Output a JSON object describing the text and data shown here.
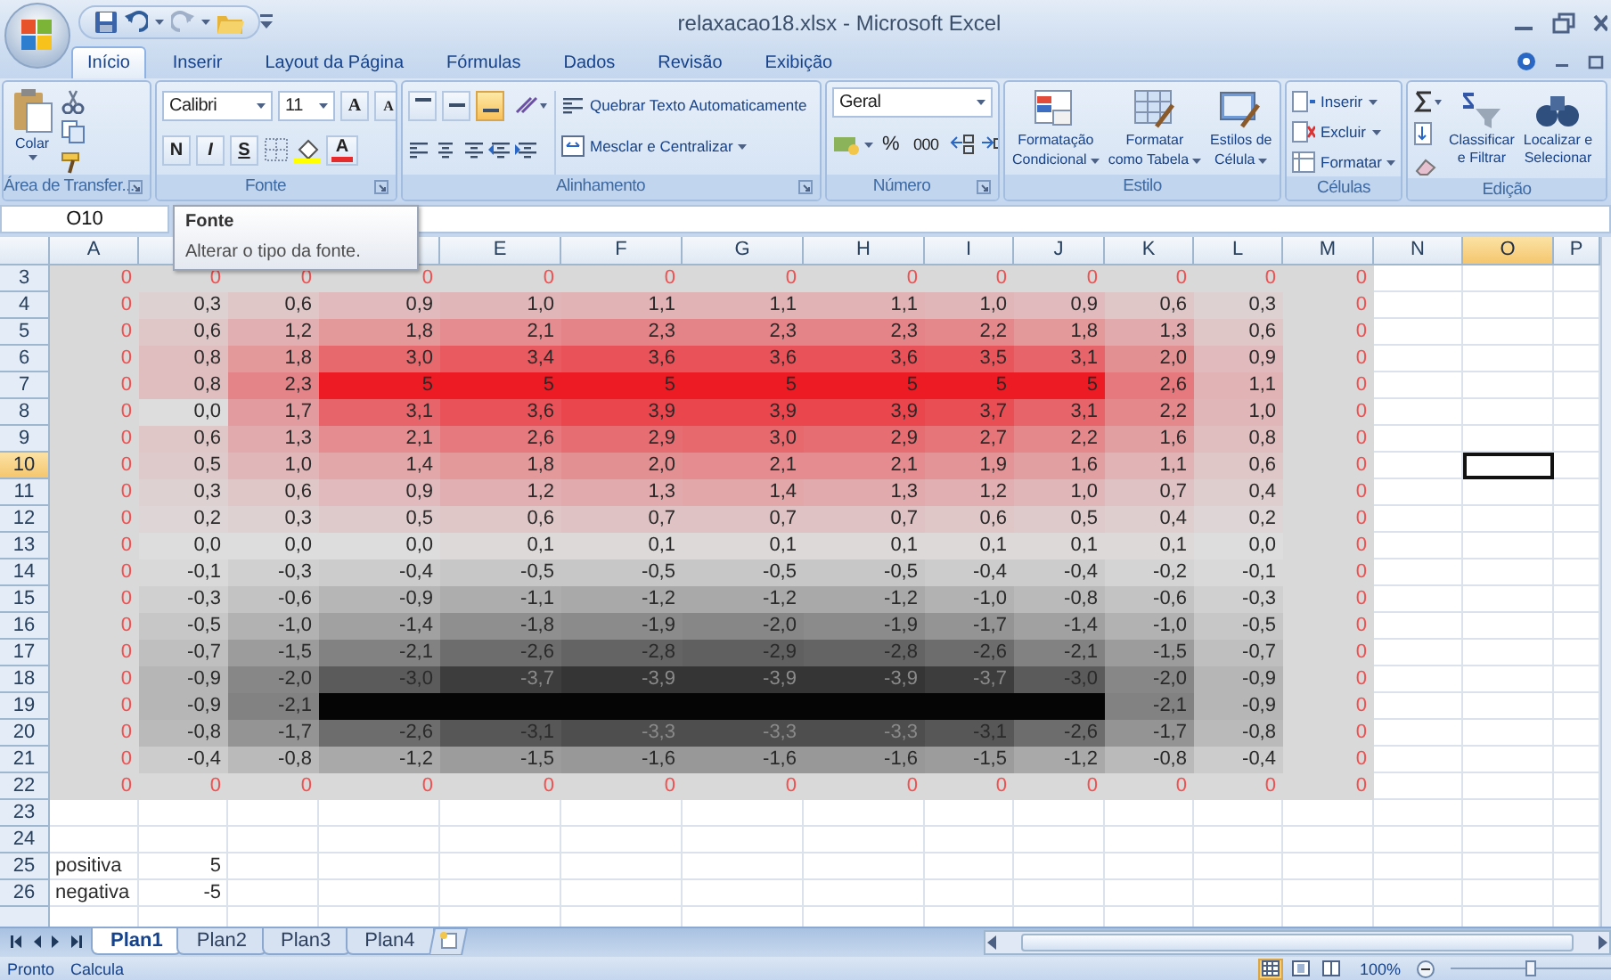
{
  "window": {
    "title": "relaxacao18.xlsx - Microsoft Excel"
  },
  "ribbon_tabs": [
    {
      "label": "Início",
      "selected": true
    },
    {
      "label": "Inserir",
      "selected": false
    },
    {
      "label": "Layout da Página",
      "selected": false
    },
    {
      "label": "Fórmulas",
      "selected": false
    },
    {
      "label": "Dados",
      "selected": false
    },
    {
      "label": "Revisão",
      "selected": false
    },
    {
      "label": "Exibição",
      "selected": false
    }
  ],
  "ribbon": {
    "clipboard": {
      "paste": "Colar",
      "group": "Área de Transfer..."
    },
    "font": {
      "name": "Calibri",
      "size": "11",
      "grow": "A",
      "shrink": "A",
      "styles": [
        "N",
        "I",
        "S"
      ],
      "font_color_label": "A",
      "group": "Fonte"
    },
    "alignment": {
      "wrap": "Quebrar Texto Automaticamente",
      "merge": "Mesclar e Centralizar",
      "group": "Alinhamento"
    },
    "number": {
      "format": "Geral",
      "percent": "%",
      "thousands": "000",
      "group": "Número"
    },
    "styles": {
      "buttons": [
        [
          "Formatação",
          "Condicional"
        ],
        [
          "Formatar",
          "como Tabela"
        ],
        [
          "Estilos de",
          "Célula"
        ]
      ],
      "group": "Estilo"
    },
    "cells": {
      "buttons": [
        "Inserir",
        "Excluir",
        "Formatar"
      ],
      "group": "Células"
    },
    "editing": {
      "buttons": [
        [
          "Classificar",
          "e Filtrar"
        ],
        [
          "Localizar e",
          "Selecionar"
        ]
      ],
      "group": "Edição"
    }
  },
  "name_box": "O10",
  "tooltip": {
    "title": "Fonte",
    "text": "Alterar o tipo da fonte."
  },
  "columns": [
    {
      "label": "A",
      "selected": false
    },
    {
      "selected": false
    },
    {
      "selected": false
    },
    {
      "selected": false
    },
    {
      "label": "E",
      "selected": false
    },
    {
      "label": "F",
      "selected": false
    },
    {
      "label": "G",
      "selected": false
    },
    {
      "label": "H",
      "selected": false
    },
    {
      "label": "I",
      "selected": false
    },
    {
      "label": "J",
      "selected": false
    },
    {
      "label": "K",
      "selected": false
    },
    {
      "label": "L",
      "selected": false
    },
    {
      "label": "M",
      "selected": false
    },
    {
      "label": "N",
      "selected": false
    },
    {
      "label": "O",
      "selected": true
    },
    {
      "label": "P",
      "selected": false
    }
  ],
  "rows": [
    {
      "number": "3",
      "selected": false,
      "cells": [
        "0",
        "0",
        "0",
        "0",
        "0",
        "0",
        "0",
        "0",
        "0",
        "0",
        "0",
        "0",
        "0"
      ]
    },
    {
      "number": "4",
      "selected": false,
      "cells": [
        "0",
        "0,3",
        "0,6",
        "0,9",
        "1,0",
        "1,1",
        "1,1",
        "1,1",
        "1,0",
        "0,9",
        "0,6",
        "0,3",
        "0"
      ]
    },
    {
      "number": "5",
      "selected": false,
      "cells": [
        "0",
        "0,6",
        "1,2",
        "1,8",
        "2,1",
        "2,3",
        "2,3",
        "2,3",
        "2,2",
        "1,8",
        "1,3",
        "0,6",
        "0"
      ]
    },
    {
      "number": "6",
      "selected": false,
      "cells": [
        "0",
        "0,8",
        "1,8",
        "3,0",
        "3,4",
        "3,6",
        "3,6",
        "3,6",
        "3,5",
        "3,1",
        "2,0",
        "0,9",
        "0"
      ]
    },
    {
      "number": "7",
      "selected": false,
      "cells": [
        "0",
        "0,8",
        "2,3",
        "5",
        "5",
        "5",
        "5",
        "5",
        "5",
        "5",
        "2,6",
        "1,1",
        "0"
      ]
    },
    {
      "number": "8",
      "selected": false,
      "cells": [
        "0",
        "0,0",
        "1,7",
        "3,1",
        "3,6",
        "3,9",
        "3,9",
        "3,9",
        "3,7",
        "3,1",
        "2,2",
        "1,0",
        "0"
      ]
    },
    {
      "number": "9",
      "selected": false,
      "cells": [
        "0",
        "0,6",
        "1,3",
        "2,1",
        "2,6",
        "2,9",
        "3,0",
        "2,9",
        "2,7",
        "2,2",
        "1,6",
        "0,8",
        "0"
      ]
    },
    {
      "number": "10",
      "selected": true,
      "cells": [
        "0",
        "0,5",
        "1,0",
        "1,4",
        "1,8",
        "2,0",
        "2,1",
        "2,1",
        "1,9",
        "1,6",
        "1,1",
        "0,6",
        "0"
      ]
    },
    {
      "number": "11",
      "selected": false,
      "cells": [
        "0",
        "0,3",
        "0,6",
        "0,9",
        "1,2",
        "1,3",
        "1,4",
        "1,3",
        "1,2",
        "1,0",
        "0,7",
        "0,4",
        "0"
      ]
    },
    {
      "number": "12",
      "selected": false,
      "cells": [
        "0",
        "0,2",
        "0,3",
        "0,5",
        "0,6",
        "0,7",
        "0,7",
        "0,7",
        "0,6",
        "0,5",
        "0,4",
        "0,2",
        "0"
      ]
    },
    {
      "number": "13",
      "selected": false,
      "cells": [
        "0",
        "0,0",
        "0,0",
        "0,0",
        "0,1",
        "0,1",
        "0,1",
        "0,1",
        "0,1",
        "0,1",
        "0,1",
        "0,0",
        "0"
      ]
    },
    {
      "number": "14",
      "selected": false,
      "cells": [
        "0",
        "-0,1",
        "-0,3",
        "-0,4",
        "-0,5",
        "-0,5",
        "-0,5",
        "-0,5",
        "-0,4",
        "-0,4",
        "-0,2",
        "-0,1",
        "0"
      ]
    },
    {
      "number": "15",
      "selected": false,
      "cells": [
        "0",
        "-0,3",
        "-0,6",
        "-0,9",
        "-1,1",
        "-1,2",
        "-1,2",
        "-1,2",
        "-1,0",
        "-0,8",
        "-0,6",
        "-0,3",
        "0"
      ]
    },
    {
      "number": "16",
      "selected": false,
      "cells": [
        "0",
        "-0,5",
        "-1,0",
        "-1,4",
        "-1,8",
        "-1,9",
        "-2,0",
        "-1,9",
        "-1,7",
        "-1,4",
        "-1,0",
        "-0,5",
        "0"
      ]
    },
    {
      "number": "17",
      "selected": false,
      "cells": [
        "0",
        "-0,7",
        "-1,5",
        "-2,1",
        "-2,6",
        "-2,8",
        "-2,9",
        "-2,8",
        "-2,6",
        "-2,1",
        "-1,5",
        "-0,7",
        "0"
      ]
    },
    {
      "number": "18",
      "selected": false,
      "cells": [
        "0",
        "-0,9",
        "-2,0",
        "-3,0",
        "-3,7",
        "-3,9",
        "-3,9",
        "-3,9",
        "-3,7",
        "-3,0",
        "-2,0",
        "-0,9",
        "0"
      ]
    },
    {
      "number": "19",
      "selected": false,
      "cells": [
        "0",
        "-0,9",
        "-2,1",
        {
          "color": "#050505"
        },
        {
          "color": "#050505"
        },
        {
          "color": "#050505"
        },
        {
          "color": "#050505"
        },
        {
          "color": "#050505"
        },
        {
          "color": "#050505"
        },
        {
          "color": "#050505"
        },
        "-2,1",
        "-0,9",
        "0"
      ]
    },
    {
      "number": "20",
      "selected": false,
      "cells": [
        "0",
        "-0,8",
        "-1,7",
        "-2,6",
        "-3,1",
        "-3,3",
        "-3,3",
        "-3,3",
        "-3,1",
        "-2,6",
        "-1,7",
        "-0,8",
        "0"
      ]
    },
    {
      "number": "21",
      "selected": false,
      "cells": [
        "0",
        "-0,4",
        "-0,8",
        "-1,2",
        "-1,5",
        "-1,6",
        "-1,6",
        "-1,6",
        "-1,5",
        "-1,2",
        "-0,8",
        "-0,4",
        "0"
      ]
    },
    {
      "number": "22",
      "selected": false,
      "cells": [
        "0",
        "0",
        "0",
        "0",
        "0",
        "0",
        "0",
        "0",
        "0",
        "0",
        "0",
        "0",
        "0"
      ]
    },
    {
      "number": "23",
      "selected": false
    },
    {
      "number": "24",
      "selected": false
    },
    {
      "number": "25",
      "selected": false,
      "cells": [
        "positiva",
        "5"
      ]
    },
    {
      "number": "26",
      "selected": false,
      "cells": [
        "negativa",
        "-5"
      ]
    }
  ],
  "sheet_tabs": [
    {
      "label": "Plan1",
      "selected": true
    },
    {
      "label": "Plan2",
      "selected": false
    },
    {
      "label": "Plan3",
      "selected": false
    },
    {
      "label": "Plan4",
      "selected": false
    }
  ],
  "status_bar": {
    "texts": [
      "Pronto",
      "Calcula"
    ],
    "views": [
      {
        "selected": true
      },
      {
        "selected": false
      },
      {
        "selected": false
      }
    ],
    "zoom": {
      "reading": "100%",
      "level": 0.5
    }
  }
}
